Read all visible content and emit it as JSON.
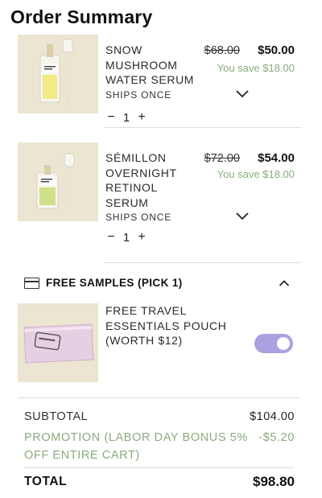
{
  "header": {
    "title": "Order Summary"
  },
  "items": [
    {
      "name": "SNOW MUSHROOM WATER SERUM",
      "price_original": "$68.00",
      "price_sale": "$50.00",
      "savings": "You save $18.00",
      "shipping": "SHIPS ONCE",
      "quantity": "1",
      "minus": "−",
      "plus": "+",
      "thumb_color": "#ece5d2",
      "product_accent": "#e8e84a"
    },
    {
      "name": "SÉMILLON OVERNIGHT RETINOL SERUM",
      "price_original": "$72.00",
      "price_sale": "$54.00",
      "savings": "You save $18.00",
      "shipping": "SHIPS ONCE",
      "quantity": "1",
      "minus": "−",
      "plus": "+",
      "thumb_color": "#ece5d2",
      "product_accent": "#c7dc7a"
    }
  ],
  "samples": {
    "title": "FREE SAMPLES (PICK 1)",
    "item_name": "FREE TRAVEL ESSENTIALS POUCH (WORTH $12)",
    "toggle_on": true,
    "toggle_color": "#a9a1e0"
  },
  "summary": {
    "subtotal_label": "SUBTOTAL",
    "subtotal_value": "$104.00",
    "promotion_label": "PROMOTION (LABOR DAY BONUS 5%",
    "promotion_value": "-$5.20",
    "promotion_line2": "OFF ENTIRE CART)",
    "total_label": "TOTAL",
    "total_value": "$98.80"
  },
  "colors": {
    "accent_green": "#8aac7c",
    "toggle": "#a9a1e0",
    "thumb_bg": "#ece5d2"
  },
  "icons": {
    "chevron_down": "chevron-down-icon",
    "chevron_up": "chevron-up-icon",
    "card": "card-icon"
  }
}
